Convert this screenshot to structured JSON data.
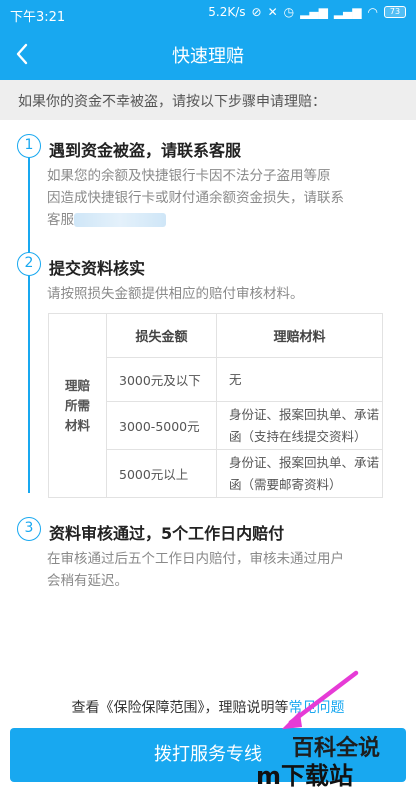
{
  "status": {
    "time": "下午3:21",
    "speed": "5.2K/s",
    "battery": "73"
  },
  "nav": {
    "title": "快速理赔"
  },
  "notice": "如果你的资金不幸被盗，请按以下步骤申请理赔：",
  "steps": [
    {
      "num": "1",
      "title": "遇到资金被盗，请联系客服",
      "desc_line1": "如果您的余额及快捷银行卡因不法分子盗用等原",
      "desc_line2": "因造成快捷银行卡或财付通余额资金损失，请联系",
      "desc_line3": "客服"
    },
    {
      "num": "2",
      "title": "提交资料核实",
      "desc": "请按照损失金额提供相应的赔付审核材料。"
    },
    {
      "num": "3",
      "title": "资料审核通过，5个工作日内赔付",
      "desc_line1": "在审核通过后五个工作日内赔付，审核未通过用户",
      "desc_line2": "会稍有延迟。"
    }
  ],
  "table": {
    "row_header_lines": [
      "理赔",
      "所需",
      "材料"
    ],
    "col_amount": "损失金额",
    "col_materials": "理赔材料",
    "rows": [
      {
        "amount": "3000元及以下",
        "mat1": "无",
        "mat2": ""
      },
      {
        "amount": "3000-5000元",
        "mat1": "身份证、报案回执单、承诺",
        "mat2": "函（支持在线提交资料）"
      },
      {
        "amount": "5000元以上",
        "mat1": "身份证、报案回执单、承诺",
        "mat2": "函（需要邮寄资料）"
      }
    ]
  },
  "footer": {
    "prefix": "查看《保险保障范围》，理赔说明等",
    "link": "常见问题"
  },
  "call_button": "拨打服务专线",
  "watermark": {
    "line1": "百科全说",
    "line2": "m下载站"
  },
  "colors": {
    "accent": "#18a8f0"
  }
}
